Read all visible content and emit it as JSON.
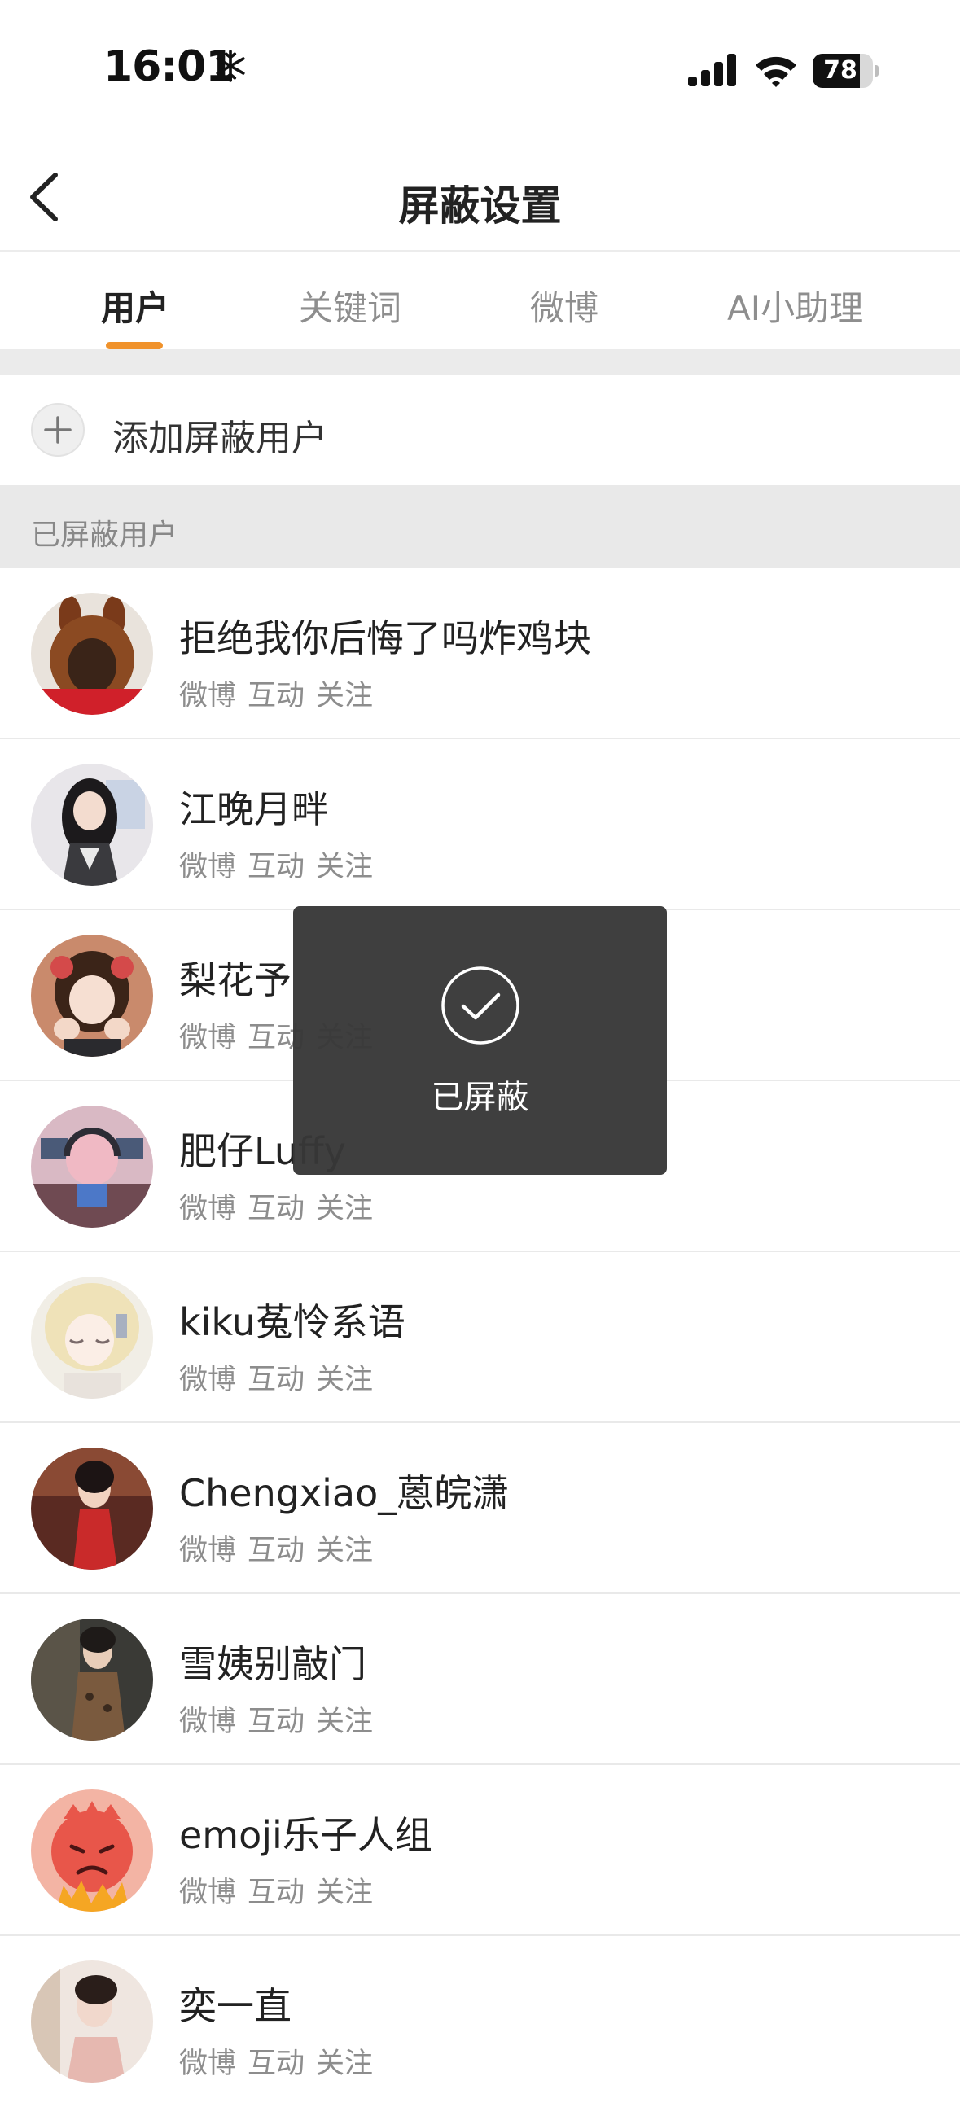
{
  "status_bar": {
    "time": "16:01",
    "battery": "78",
    "battery_level": 0.78
  },
  "nav": {
    "title": "屏蔽设置"
  },
  "tabs": [
    {
      "label": "用户",
      "active": true
    },
    {
      "label": "关键词",
      "active": false
    },
    {
      "label": "微博",
      "active": false
    },
    {
      "label": "AI小助理",
      "active": false
    }
  ],
  "add_user": {
    "label": "添加屏蔽用户"
  },
  "section": {
    "title": "已屏蔽用户"
  },
  "meta_labels": [
    "微博",
    "互动",
    "关注"
  ],
  "users": [
    {
      "name": "拒绝我你后悔了吗炸鸡块"
    },
    {
      "name": "江晚月畔"
    },
    {
      "name": "梨花予"
    },
    {
      "name": "肥仔Luffy"
    },
    {
      "name": "kiku菟怜系语"
    },
    {
      "name": "Chengxiao_蒽皖潇"
    },
    {
      "name": "雪姨别敲门"
    },
    {
      "name": "emoji乐子人组"
    },
    {
      "name": "奕一直"
    }
  ],
  "toast": {
    "text": "已屏蔽"
  },
  "colors": {
    "accent": "#f0922b",
    "toast_bg": "#373737",
    "divider": "#e9e9e9"
  }
}
